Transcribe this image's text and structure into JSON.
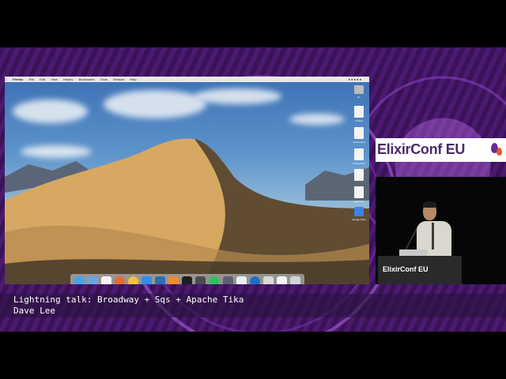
{
  "colors": {
    "band_purple": "#3d1160",
    "brand_purple": "#4a2a6a",
    "brand_orange": "#e85a2a",
    "lower_third_text": "#ffffff"
  },
  "screen": {
    "menubar": {
      "app": "Firefox",
      "items": [
        "File",
        "Edit",
        "View",
        "History",
        "Bookmarks",
        "Tools",
        "Window",
        "Help"
      ]
    },
    "desktop_icons": [
      {
        "icon": "drive-icon",
        "label": "Ex"
      },
      {
        "icon": "document-icon",
        "label": "Untitled"
      },
      {
        "icon": "document-icon",
        "label": "Screenshot"
      },
      {
        "icon": "document-icon",
        "label": "Screenshot"
      },
      {
        "icon": "document-icon",
        "label": ""
      },
      {
        "icon": "document-icon",
        "label": "spotman"
      },
      {
        "icon": "google-drive-icon",
        "label": "Google Drive"
      }
    ],
    "dock_apps": [
      "finder-icon",
      "mail-icon",
      "calendar-icon",
      "firefox-icon",
      "chrome-icon",
      "appstore-icon",
      "vscode-icon",
      "sublime-icon",
      "terminal-icon",
      "activity-monitor-icon",
      "spotify-icon",
      "xcode-icon",
      "iterm-icon",
      "keynote-icon",
      "preview-icon",
      "document-icon",
      "trash-icon"
    ]
  },
  "branding": {
    "logo_text": "ElixirConf EU",
    "podium_text": "ElixirConf EU"
  },
  "lower_third": {
    "title": "Lightning talk: Broadway + Sqs + Apache Tika",
    "speaker": "Dave Lee"
  }
}
